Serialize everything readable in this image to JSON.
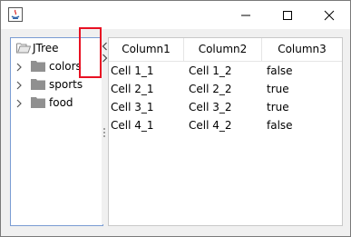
{
  "window": {
    "controls": {
      "minimize_icon": "minimize-icon",
      "maximize_icon": "maximize-icon",
      "close_icon": "close-icon"
    }
  },
  "tree": {
    "root": {
      "label": "JTree",
      "icon": "folder-open-icon"
    },
    "children": [
      {
        "label": "colors",
        "icon": "folder-icon"
      },
      {
        "label": "sports",
        "icon": "folder-icon"
      },
      {
        "label": "food",
        "icon": "folder-icon"
      }
    ]
  },
  "table": {
    "columns": [
      "Column1",
      "Column2",
      "Column3"
    ],
    "rows": [
      [
        "Cell 1_1",
        "Cell 1_2",
        "false"
      ],
      [
        "Cell 2_1",
        "Cell 2_2",
        "true"
      ],
      [
        "Cell 3_1",
        "Cell 3_2",
        "true"
      ],
      [
        "Cell 4_1",
        "Cell 4_2",
        "false"
      ]
    ]
  },
  "colors": {
    "highlight": "#e81123",
    "tree_border": "#7a9cd3"
  }
}
